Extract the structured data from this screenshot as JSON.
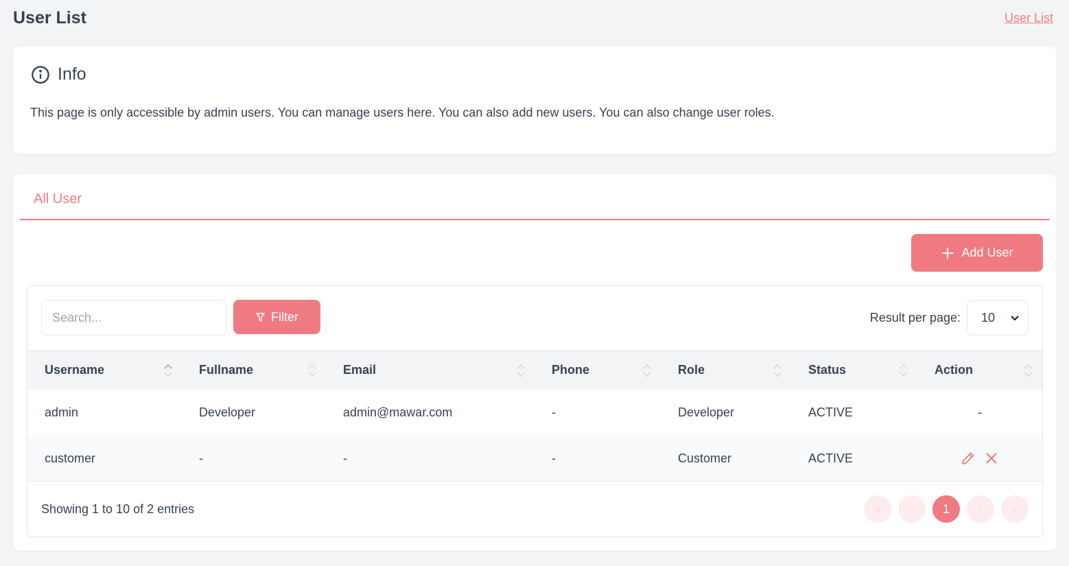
{
  "header": {
    "title": "User List",
    "breadcrumb": "User List"
  },
  "info": {
    "title": "Info",
    "text": "This page is only accessible by admin users. You can manage users here. You can also add new users. You can also change user roles."
  },
  "tabs": [
    {
      "label": "All User",
      "active": true
    }
  ],
  "toolbar": {
    "add_user_label": "Add User",
    "search_placeholder": "Search...",
    "filter_label": "Filter",
    "rpp_label": "Result per page:",
    "rpp_value": "10"
  },
  "table": {
    "columns": [
      "Username",
      "Fullname",
      "Email",
      "Phone",
      "Role",
      "Status",
      "Action"
    ],
    "rows": [
      {
        "username": "admin",
        "fullname": "Developer",
        "email": "admin@mawar.com",
        "phone": "-",
        "role": "Developer",
        "status": "ACTIVE",
        "action": "-"
      },
      {
        "username": "customer",
        "fullname": "-",
        "email": "-",
        "phone": "-",
        "role": "Customer",
        "status": "ACTIVE",
        "action": "edit-delete"
      }
    ]
  },
  "footer": {
    "entries_text": "Showing 1 to 10 of 2 entries",
    "first": "«",
    "prev": "‹",
    "current_page": "1",
    "next": "›",
    "last": "»"
  },
  "colors": {
    "accent": "#f07a82",
    "background": "#f3f4f6",
    "text": "#374151"
  },
  "icons": {
    "info": "info-circle-icon",
    "add": "plus-icon",
    "filter": "filter-icon",
    "select": "chevron-down-icon",
    "sort": "sort-icon",
    "edit": "pencil-icon",
    "delete": "close-icon"
  }
}
